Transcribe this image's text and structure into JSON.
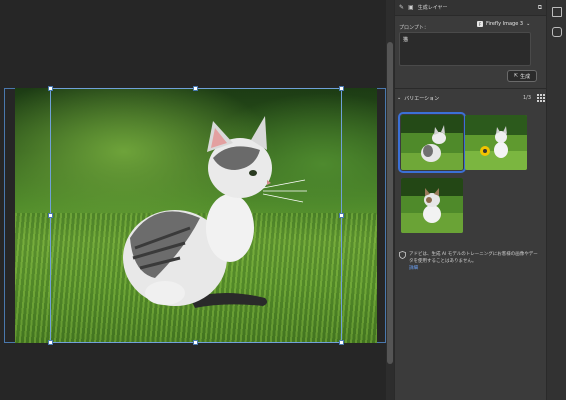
{
  "panel": {
    "layer_label": "生成レイヤー",
    "prompt_label": "プロンプト：",
    "model_label": "Firefly Image 3",
    "prompt_text": "猫",
    "generate_label": "生成",
    "variations_label": "バリエーション",
    "variations_count": "1/3",
    "disclaimer_text": "アドビは、生成 AI モデルのトレーニングにお客様の画像やデータを使用することはありません。",
    "disclaimer_link": "詳細"
  },
  "icons": {
    "layer": "layer-icon",
    "settings": "settings-icon",
    "model": "firefly-icon",
    "chevron": "chevron-down-icon",
    "generate": "generate-icon",
    "grid": "grid-view-icon",
    "shield": "shield-icon"
  },
  "colors": {
    "accent": "#3b70d6",
    "link": "#6fa7ff",
    "canvas_bg": "#262626",
    "panel_bg": "#3b3b3b"
  }
}
